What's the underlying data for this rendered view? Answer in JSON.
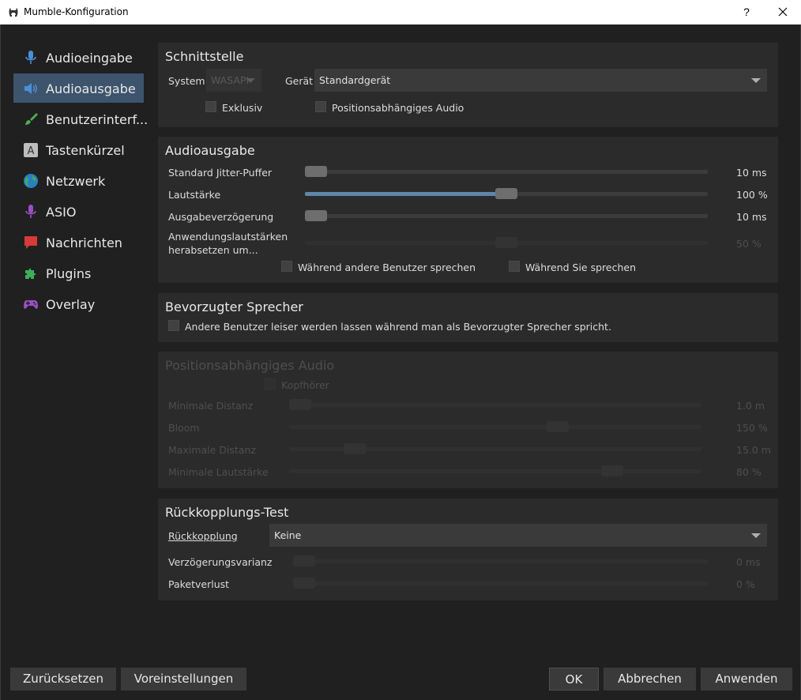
{
  "window": {
    "title": "Mumble-Konfiguration",
    "help_label": "?"
  },
  "sidebar": {
    "items": [
      {
        "label": "Audioeingabe",
        "icon": "microphone-icon",
        "color": "#4a90d9"
      },
      {
        "label": "Audioausgabe",
        "icon": "speaker-icon",
        "color": "#4a90d9",
        "selected": true
      },
      {
        "label": "Benutzerinterf...",
        "icon": "brush-icon",
        "color": "#4caf50"
      },
      {
        "label": "Tastenkürzel",
        "icon": "keyboard-key-icon",
        "color": "#bdbdbd"
      },
      {
        "label": "Netzwerk",
        "icon": "globe-icon",
        "color": "#2e9b5f"
      },
      {
        "label": "ASIO",
        "icon": "asio-microphone-icon",
        "color": "#9b4fc0"
      },
      {
        "label": "Nachrichten",
        "icon": "message-icon",
        "color": "#d63a3a"
      },
      {
        "label": "Plugins",
        "icon": "puzzle-icon",
        "color": "#3fae5a"
      },
      {
        "label": "Overlay",
        "icon": "gamepad-icon",
        "color": "#9b4fc0"
      }
    ]
  },
  "interface": {
    "title": "Schnittstelle",
    "system_label": "System",
    "system_value": "WASAPI",
    "device_label": "Gerät",
    "device_value": "Standardgerät",
    "exclusive_label": "Exklusiv",
    "positional_label": "Positionsabhängiges Audio"
  },
  "output": {
    "title": "Audioausgabe",
    "jitter_label": "Standard Jitter-Puffer",
    "jitter_value": "10 ms",
    "jitter_level": 0.0,
    "volume_label": "Lautstärke",
    "volume_value": "100 %",
    "volume_level": 0.5,
    "delay_label": "Ausgabeverzögerung",
    "delay_value": "10 ms",
    "delay_level": 0.0,
    "attenuate_label_1": "Anwendungslautstärken",
    "attenuate_label_2": "herabsetzen um...",
    "attenuate_value": "50 %",
    "attenuate_level": 0.5,
    "while_others_label": "Während andere Benutzer sprechen",
    "while_you_label": "Während Sie sprechen"
  },
  "priority": {
    "title": "Bevorzugter Sprecher",
    "checkbox_label": "Andere Benutzer leiser werden lassen während man als Bevorzugter Sprecher spricht."
  },
  "positional": {
    "title": "Positionsabhängiges Audio",
    "headphones_label": "Kopfhörer",
    "min_distance_label": "Minimale Distanz",
    "min_distance_value": "1.0 m",
    "min_distance_level": 0.0,
    "bloom_label": "Bloom",
    "bloom_value": "150 %",
    "bloom_level": 0.66,
    "max_distance_label": "Maximale Distanz",
    "max_distance_value": "15.0 m",
    "max_distance_level": 0.14,
    "min_volume_label": "Minimale Lautstärke",
    "min_volume_value": "80 %",
    "min_volume_level": 0.8
  },
  "loopback": {
    "title": "Rückkopplungs-Test",
    "loopback_label": "Rückkopplung",
    "loopback_value": "Keine",
    "variance_label": "Verzögerungsvarianz",
    "variance_value": "0 ms",
    "variance_level": 0.0,
    "loss_label": "Paketverlust",
    "loss_value": "0 %",
    "loss_level": 0.0
  },
  "footer": {
    "reset_label": "Zurücksetzen",
    "defaults_label": "Voreinstellungen",
    "ok_label": "OK",
    "cancel_label": "Abbrechen",
    "apply_label": "Anwenden"
  }
}
